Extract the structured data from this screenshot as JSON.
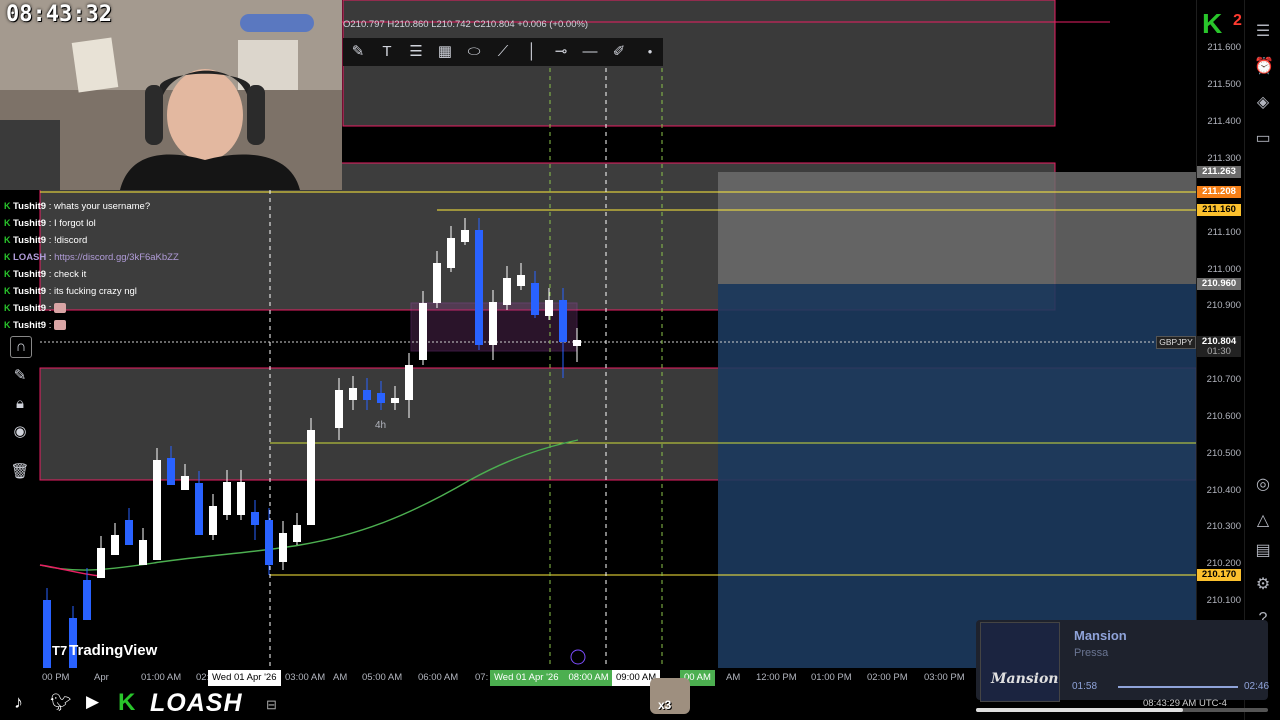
{
  "webcam": {
    "clock": "08:43:32"
  },
  "ohlc": {
    "text": "O210.797 H210.860 L210.742 C210.804 +0.006 (+0.00%)"
  },
  "chat": [
    {
      "user": "Tushit9",
      "msg": "whats your username?",
      "link": false
    },
    {
      "user": "Tushit9",
      "msg": "I forgot lol",
      "link": false
    },
    {
      "user": "Tushit9",
      "msg": "!discord",
      "link": false
    },
    {
      "user": "LOASH",
      "msg": "https://discord.gg/3kF6aKbZZ",
      "link": true
    },
    {
      "user": "Tushit9",
      "msg": "check it",
      "link": false
    },
    {
      "user": "Tushit9",
      "msg": "its fucking crazy ngl",
      "link": false
    },
    {
      "user": "Tushit9",
      "msg": "",
      "link": false
    },
    {
      "user": "Tushit9",
      "msg": "",
      "link": false
    }
  ],
  "price_axis": {
    "ticks": [
      "211.600",
      "211.500",
      "211.400",
      "211.300",
      "211.100",
      "211.000",
      "210.900",
      "210.700",
      "210.600",
      "210.500",
      "210.400",
      "210.300",
      "210.200",
      "210.100"
    ],
    "labels": {
      "l263": "211.263",
      "l208": "211.208",
      "l160": "211.160",
      "l960": "210.960",
      "l804": "210.804",
      "l804_time": "01:30",
      "l170": "210.170",
      "symbol": "GBPJPY"
    }
  },
  "time_axis": {
    "ticks": [
      "00 PM",
      "Apr",
      "01:00 AM",
      "02:",
      "03:00 AM",
      "AM",
      "05:00 AM",
      "06:00 AM",
      "07:",
      "AM",
      "12:00 PM",
      "01:00 PM",
      "02:00 PM",
      "03:00 PM"
    ],
    "label_left": "Wed 01 Apr '26",
    "label_mid": "Wed 01 Apr '26",
    "label_mid_time": "08:00 AM",
    "label_right": "09:00 AM",
    "label_right2": "00 AM"
  },
  "chart": {
    "interval_label": "4h",
    "watermark": "TradingView"
  },
  "branding": {
    "logo": "LOASH",
    "k_badge": "K",
    "k_count": "2"
  },
  "music": {
    "title": "Mansion",
    "artist": "Pressa",
    "elapsed": "01:58",
    "total": "02:46",
    "progress": 0.71
  },
  "status": {
    "time": "08:43:29 AM UTC-4",
    "emote_count": "x3"
  },
  "colors": {
    "up": "#ffffff",
    "down": "#2962ff",
    "ema": "#4caf50",
    "zone_red": "#e91e63",
    "yellow": "#ffeb3b",
    "accent_green": "#29c52b"
  }
}
